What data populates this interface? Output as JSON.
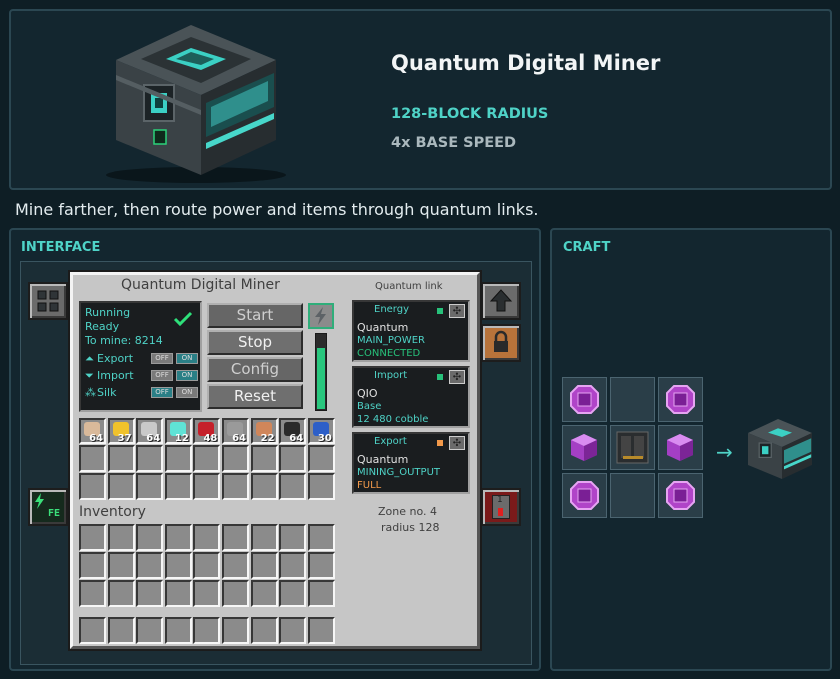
{
  "header": {
    "title": "Quantum Digital Miner",
    "spec_radius": "128-BLOCK RADIUS",
    "spec_speed": "4x BASE SPEED"
  },
  "description": "Mine farther, then route power and items through quantum links.",
  "sections": {
    "interface": "INTERFACE",
    "craft": "CRAFT"
  },
  "gui": {
    "title": "Quantum Digital Miner",
    "quantum_title": "Quantum link",
    "status": {
      "line1": "Running",
      "line2": "Ready",
      "to_mine": "To mine: 8214"
    },
    "toggles": [
      {
        "label": "Export",
        "off": "OFF",
        "on": "ON"
      },
      {
        "label": "Import",
        "off": "OFF",
        "on": "ON"
      },
      {
        "label": "Silk",
        "off": "OFF",
        "on": "ON"
      }
    ],
    "buttons": {
      "start": "Start",
      "stop": "Stop",
      "config": "Config",
      "reset": "Reset"
    },
    "energy_fill_percent": 80,
    "ores": [
      {
        "count": "64",
        "color": "#d9b99a"
      },
      {
        "count": "37",
        "color": "#f0c22b"
      },
      {
        "count": "64",
        "color": "#c9c9c9"
      },
      {
        "count": "12",
        "color": "#5fe3d6"
      },
      {
        "count": "48",
        "color": "#c5202a"
      },
      {
        "count": "64",
        "color": "#9a9a9a"
      },
      {
        "count": "22",
        "color": "#d0865a"
      },
      {
        "count": "64",
        "color": "#2a2a2a"
      },
      {
        "count": "30",
        "color": "#2d5fc8"
      }
    ],
    "inventory_label": "Inventory",
    "links": [
      {
        "title": "Energy",
        "name": "Quantum",
        "detail": "MAIN_POWER",
        "status": "CONNECTED",
        "led": "#27c17a",
        "status_color": "#27c17a"
      },
      {
        "title": "Import",
        "name": "QIO",
        "detail": "Base",
        "status": "12 480 cobble",
        "led": "#27c17a",
        "status_color": "#4fd3c7"
      },
      {
        "title": "Export",
        "name": "Quantum",
        "detail": "MINING_OUTPUT",
        "status": "FULL",
        "led": "#f2994a",
        "status_color": "#f2994a"
      }
    ],
    "zone": {
      "line1": "Zone no. 4",
      "line2": "radius 128"
    },
    "side": {
      "fe_label": "FE",
      "redstone_count": "1"
    }
  },
  "colors": {
    "accent": "#4fd3c7",
    "background": "#0e1e25",
    "panel": "#13262f"
  },
  "craft": {
    "grid": [
      "octagon",
      "empty",
      "octagon",
      "cube",
      "miner",
      "cube",
      "octagon",
      "empty",
      "octagon"
    ],
    "arrow": "→"
  }
}
